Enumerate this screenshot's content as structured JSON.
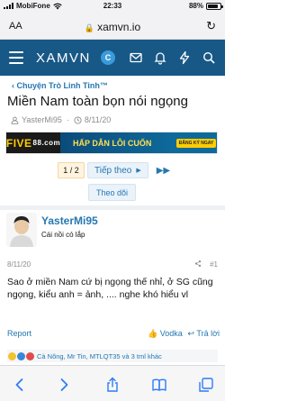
{
  "status_bar": {
    "carrier": "MobiFone",
    "time": "22:33",
    "battery": "88%",
    "battery_level": 0.88
  },
  "browser": {
    "text_size_label": "AA",
    "url": "xamvn.io"
  },
  "site_header": {
    "logo": "XAMVN",
    "avatar_letter": "C"
  },
  "breadcrumb": "Chuyện Trò Linh Tinh™",
  "thread": {
    "title": "Miền Nam toàn bọn nói ngọng",
    "author": "YasterMi95",
    "date": "8/11/20"
  },
  "banner": {
    "brand": "FIVE",
    "brand_suffix": "88.com",
    "promo_text": "HẤP DẪN LÔI CUỐN",
    "cta": "ĐĂNG KÝ NGAY"
  },
  "pagination": {
    "current": "1 / 2",
    "next_label": "Tiếp theo"
  },
  "follow_label": "Theo dõi",
  "post": {
    "username": "YasterMi95",
    "user_title": "Cái nồi có lắp",
    "date": "8/11/20",
    "number": "#1",
    "content": "Sao ở miền Nam cứ bị ngọng thế nhỉ, ở SG cũng ngọng, kiểu anh = ảnh, .... nghe khó hiểu vl",
    "report_label": "Report",
    "react_label": "Vodka",
    "reply_label": "Trả lời",
    "reactions_text": "Cà Nông, Mr Tin, MTLQT35 và 3 tml khác"
  },
  "colors": {
    "header": "#185886",
    "link": "#2577b1",
    "ios_blue": "#2f7cf6"
  },
  "toolbar_icons": [
    "back-icon",
    "forward-icon",
    "share-icon",
    "bookmarks-icon",
    "tabs-icon"
  ]
}
